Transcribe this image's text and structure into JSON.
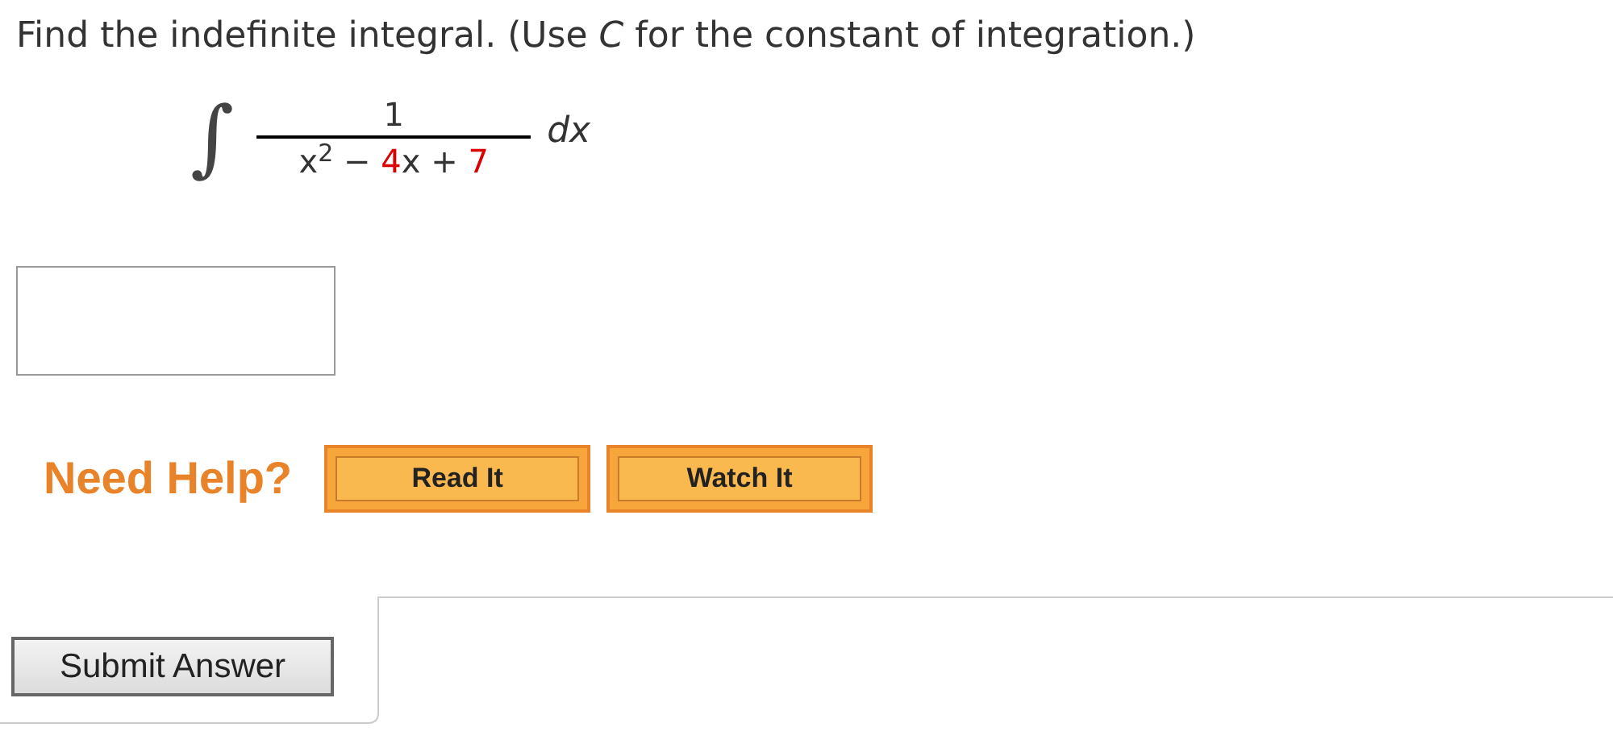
{
  "question": "Find the indefinite integral. (Use *C* for the constant of integration.)",
  "integral": {
    "sign": "∫",
    "numerator": "1",
    "denominator": [
      {
        "text": "x$^{2}$ − ",
        "color": "#333333"
      },
      {
        "text": "4",
        "color": "#dd0000"
      },
      {
        "text": "x + ",
        "color": "#333333"
      },
      {
        "text": "7",
        "color": "#dd0000"
      }
    ],
    "differential": "dx"
  },
  "help": {
    "label": "Need Help?",
    "buttons": [
      "Read It",
      "Watch It"
    ]
  },
  "submit": "Submit Answer"
}
